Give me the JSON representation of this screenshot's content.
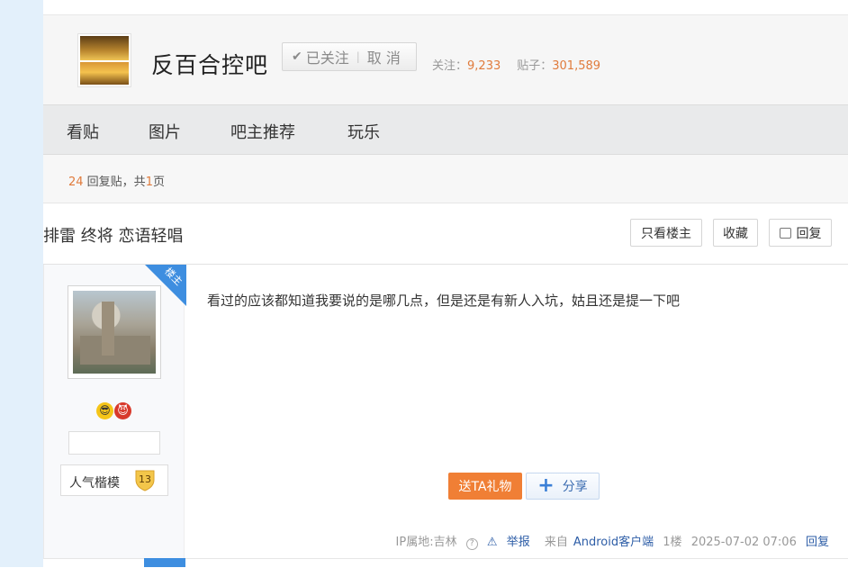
{
  "forum": {
    "name": "反百合控吧",
    "follow_label": "已关注",
    "cancel_label": "取 消",
    "follow_count_label": "关注：",
    "follow_count": "9,233",
    "post_count_label": "贴子：",
    "post_count": "301,589"
  },
  "nav": {
    "tabs": [
      "看贴",
      "图片",
      "吧主推荐",
      "玩乐"
    ]
  },
  "reply_info": {
    "count": "24",
    "text_mid": " 回复贴，共",
    "pages": "1",
    "text_end": "页"
  },
  "thread": {
    "title": "排雷 终将 恋语轻唱",
    "only_op_label": "只看楼主",
    "favorite_label": "收藏",
    "reply_label": "回复"
  },
  "post": {
    "op_badge": "楼主",
    "author_badge_name": "人气楷模",
    "author_badge_level": "13",
    "content": "看过的应该都知道我要说的是哪几点，但是还是有新人入坑，姑且还是提一下吧",
    "gift_label": "送TA礼物",
    "share_label": "分享",
    "ip_label": "IP属地:吉林",
    "report_label": "举报",
    "source_prefix": "来自",
    "source_client": "Android客户端",
    "floor": "1楼",
    "time": "2025-07-02 07:06",
    "reply_label": "回复"
  },
  "colors": {
    "accent_orange": "#e07b3c",
    "link_blue": "#2e5ea7",
    "ribbon_blue": "#3e8ee0",
    "gift_orange": "#f07f35"
  }
}
